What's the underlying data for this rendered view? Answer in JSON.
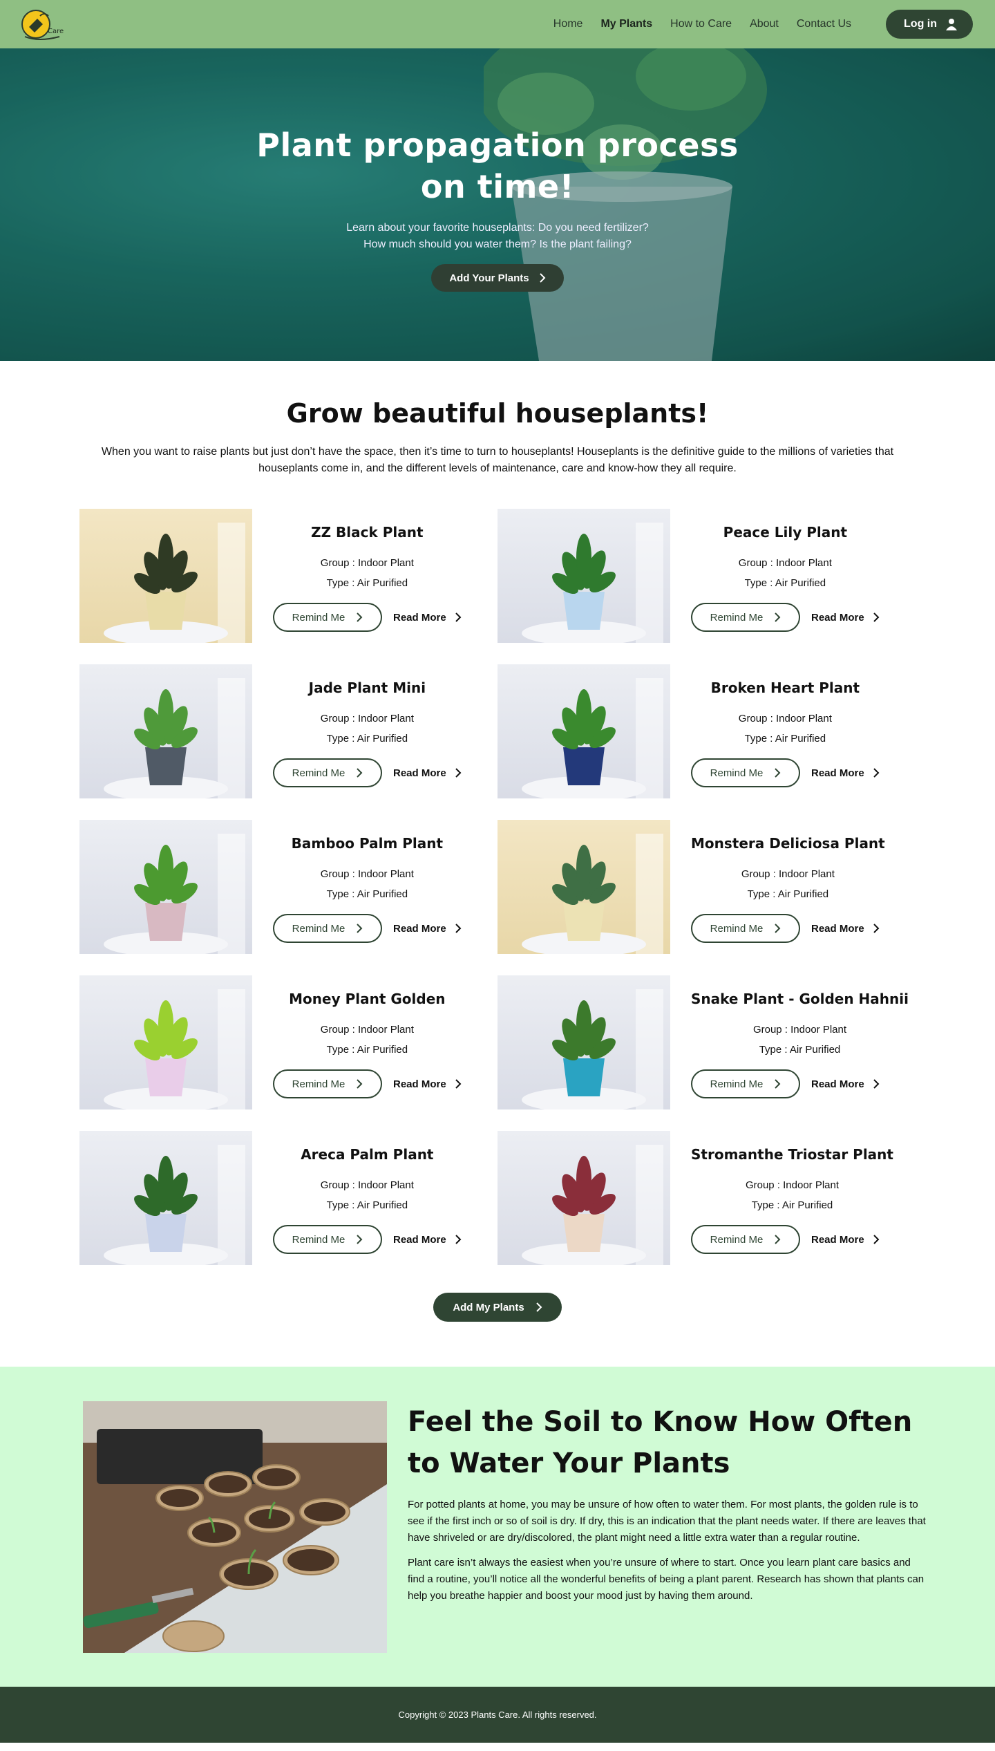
{
  "nav": {
    "logo_text": "Care",
    "items": [
      {
        "label": "Home",
        "active": false
      },
      {
        "label": "My Plants",
        "active": true
      },
      {
        "label": "How to Care",
        "active": false
      },
      {
        "label": "About",
        "active": false
      },
      {
        "label": "Contact Us",
        "active": false
      }
    ],
    "login_label": "Log in"
  },
  "hero": {
    "title_line1": "Plant propagation process",
    "title_line2": "on time!",
    "subtitle_line1": "Learn about your favorite houseplants: Do you need fertilizer?",
    "subtitle_line2": "How much should you water them? Is the plant failing?",
    "button_label": "Add Your Plants"
  },
  "grow": {
    "title": "Grow beautiful houseplants!",
    "lead": "When you want to raise plants but just don’t have the space, then it’s time to turn to houseplants! Houseplants is the definitive guide to the millions of varieties that houseplants come in, and the different levels of maintenance, care and know-how they all require."
  },
  "plants": [
    {
      "name": "ZZ Black Plant",
      "group": "Group : Indoor Plant",
      "type": "Type : Air Purified",
      "remind": "Remind Me",
      "read": "Read More",
      "bg": "warm",
      "pot": "#e8dca8",
      "leaf": "#2f3a24"
    },
    {
      "name": "Peace Lily Plant",
      "group": "Group : Indoor Plant",
      "type": "Type : Air Purified",
      "remind": "Remind Me",
      "read": "Read More",
      "bg": "cool",
      "pot": "#b9d6ee",
      "leaf": "#2f7a2e"
    },
    {
      "name": "Jade Plant Mini",
      "group": "Group : Indoor Plant",
      "type": "Type : Air Purified",
      "remind": "Remind Me",
      "read": "Read More",
      "bg": "cool",
      "pot": "#505a66",
      "leaf": "#4f9a3a"
    },
    {
      "name": "Broken Heart Plant",
      "group": "Group : Indoor Plant",
      "type": "Type : Air Purified",
      "remind": "Remind Me",
      "read": "Read More",
      "bg": "cool",
      "pot": "#23397a",
      "leaf": "#3a8a2e"
    },
    {
      "name": "Bamboo Palm Plant",
      "group": "Group : Indoor Plant",
      "type": "Type : Air Purified",
      "remind": "Remind Me",
      "read": "Read More",
      "bg": "cool",
      "pot": "#d8b9c2",
      "leaf": "#4c9a30"
    },
    {
      "name": "Monstera Deliciosa Plant",
      "group": "Group : Indoor Plant",
      "type": "Type : Air Purified",
      "remind": "Remind Me",
      "read": "Read More",
      "bg": "warm",
      "pot": "#ece2b4",
      "leaf": "#3f6f45"
    },
    {
      "name": "Money Plant Golden",
      "group": "Group : Indoor Plant",
      "type": "Type : Air Purified",
      "remind": "Remind Me",
      "read": "Read More",
      "bg": "cool",
      "pot": "#e9cde9",
      "leaf": "#9ad030"
    },
    {
      "name": "Snake Plant - Golden Hahnii",
      "group": "Group : Indoor Plant",
      "type": "Type : Air Purified",
      "remind": "Remind Me",
      "read": "Read More",
      "bg": "cool",
      "pot": "#2aa3c2",
      "leaf": "#3c7a2c"
    },
    {
      "name": "Areca Palm Plant",
      "group": "Group : Indoor Plant",
      "type": "Type : Air Purified",
      "remind": "Remind Me",
      "read": "Read More",
      "bg": "cool",
      "pot": "#c9d3ea",
      "leaf": "#2e6a2a"
    },
    {
      "name": "Stromanthe Triostar Plant",
      "group": "Group : Indoor Plant",
      "type": "Type : Air Purified",
      "remind": "Remind Me",
      "read": "Read More",
      "bg": "cool",
      "pot": "#ecd8c6",
      "leaf": "#8a2e3a"
    }
  ],
  "add_my_plants_label": "Add My Plants",
  "soil": {
    "title": "Feel the Soil to Know How Often to Water Your Plants",
    "p1": "For potted plants at home, you may be unsure of how often to water them. For most plants, the golden rule is to see if the first inch or so of soil is dry. If dry, this is an indication that the plant needs water. If there are leaves that have shriveled or are dry/discolored, the plant might need a little extra water than a regular routine.",
    "p2": "Plant care isn’t always the easiest when you’re unsure of where to start. Once you learn plant care basics and find a routine, you’ll notice all the wonderful benefits of being a plant parent. Research has shown that plants can help you breathe happier and boost your mood just by having them around."
  },
  "footer": {
    "copyright": "Copyright © 2023 Plants Care. All rights reserved."
  },
  "colors": {
    "nav_bg": "#8fbf83",
    "brand_dark": "#2f4533",
    "hero_teal": "#1c7068",
    "soil_bg": "#d0fbd5"
  }
}
